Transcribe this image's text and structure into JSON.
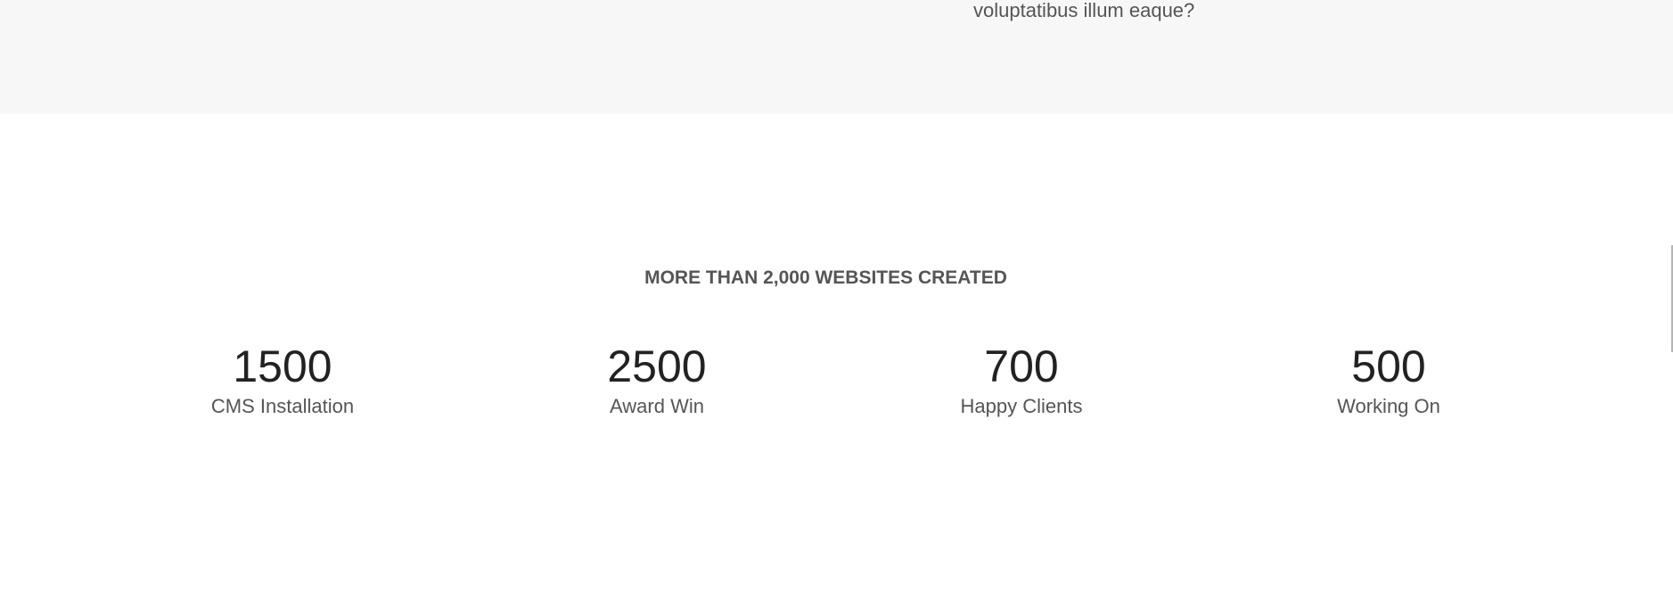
{
  "intro": {
    "text_tail": "voluptatibus illum eaque?"
  },
  "stats": {
    "heading": "MORE THAN 2,000 WEBSITES CREATED",
    "items": [
      {
        "value": "1500",
        "label": "CMS Installation"
      },
      {
        "value": "2500",
        "label": "Award Win"
      },
      {
        "value": "700",
        "label": "Happy Clients"
      },
      {
        "value": "500",
        "label": "Working On"
      }
    ]
  }
}
